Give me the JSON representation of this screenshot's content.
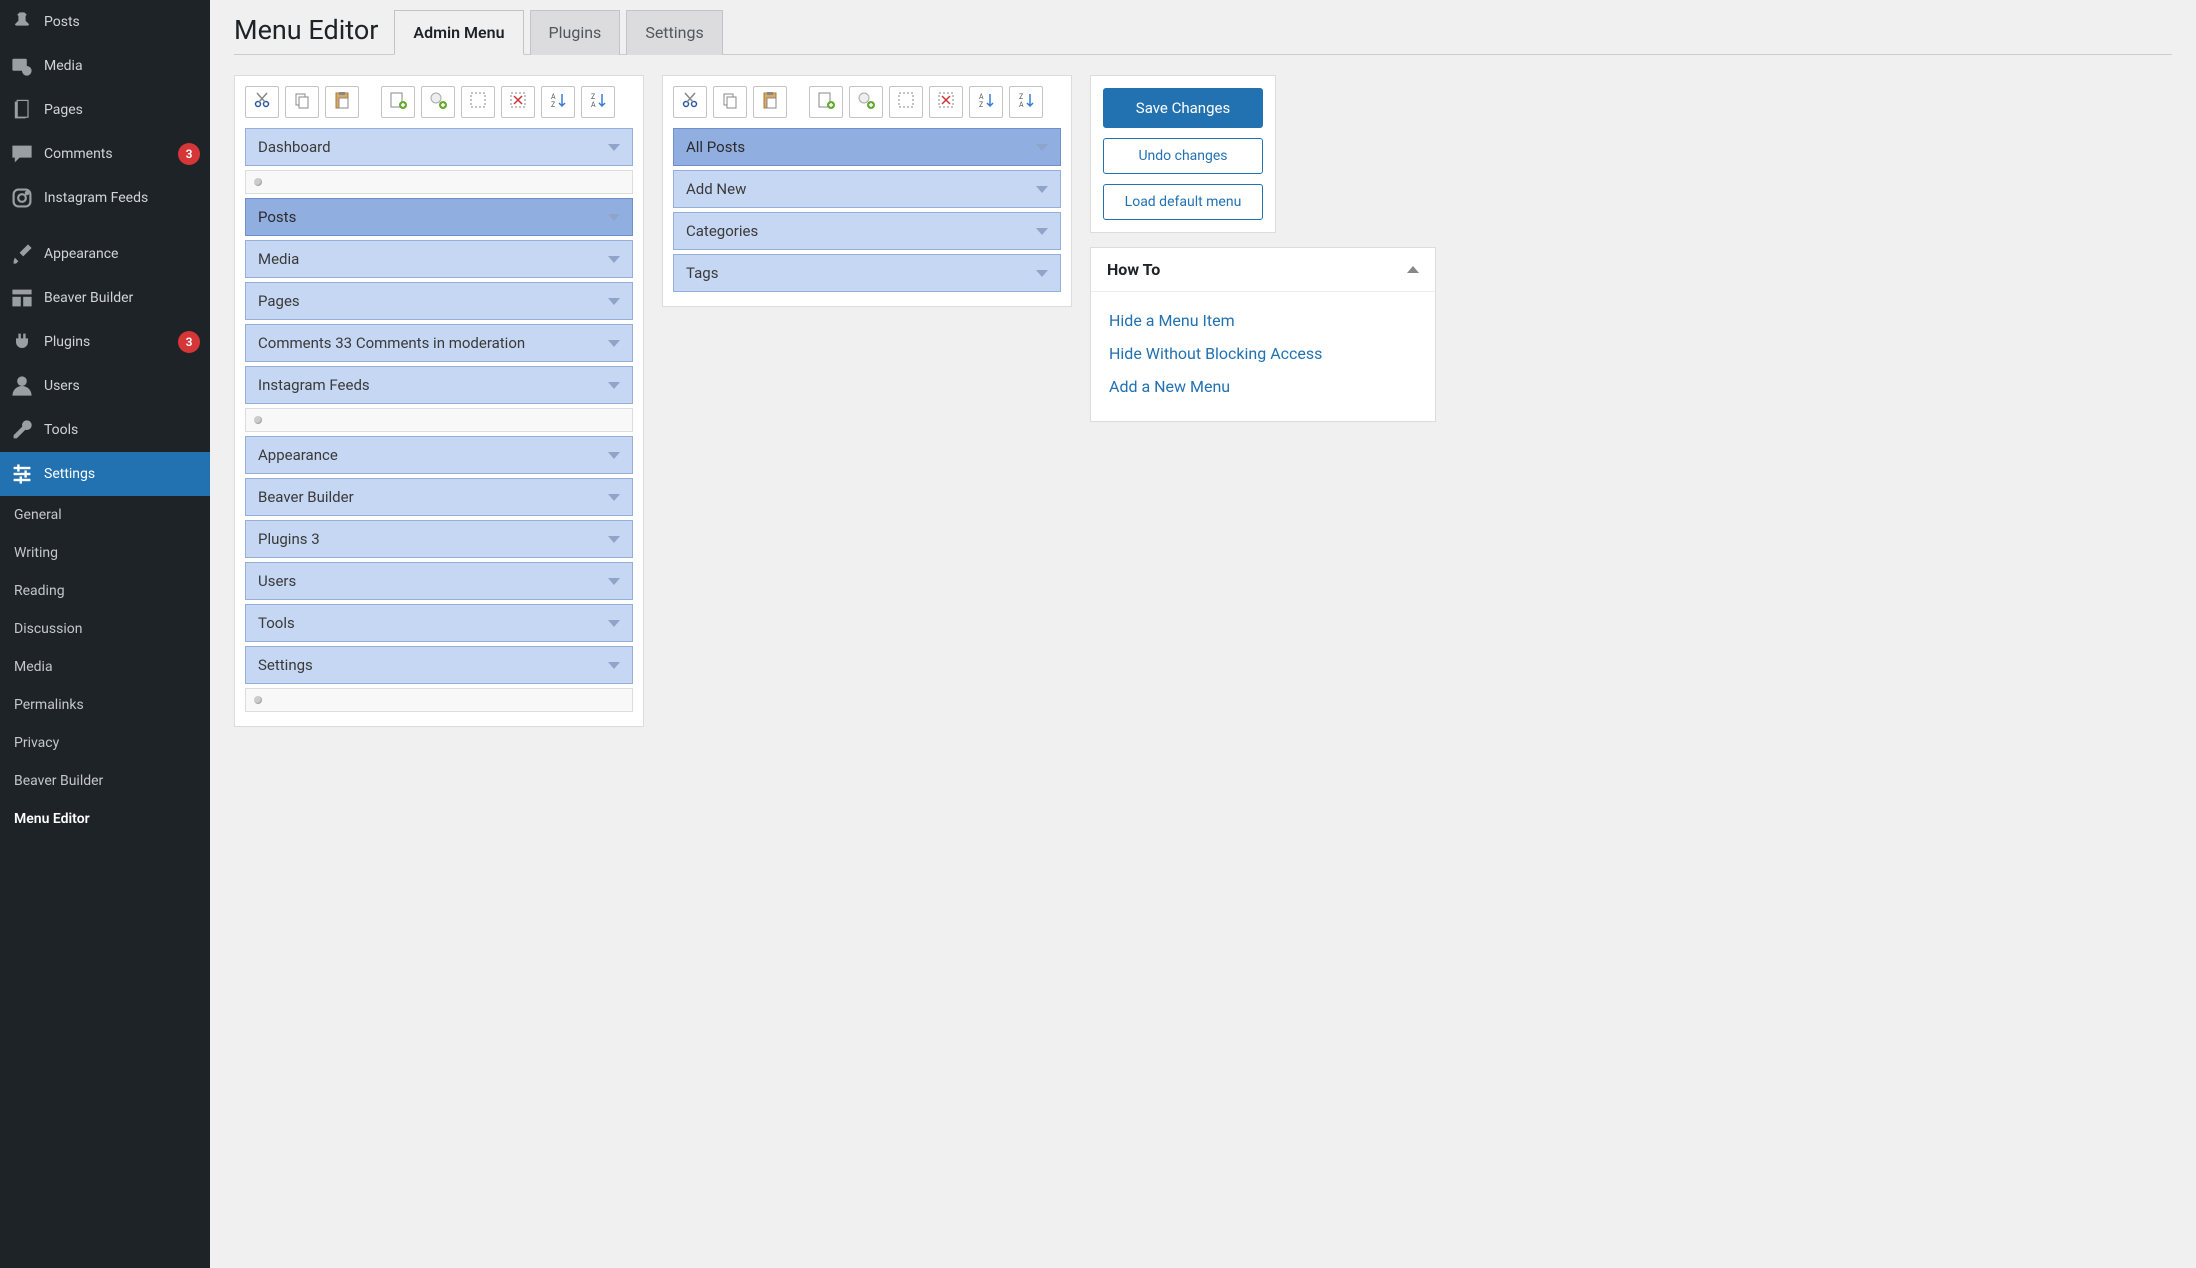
{
  "sidebar": {
    "items": [
      {
        "label": "Posts",
        "icon": "pin"
      },
      {
        "label": "Media",
        "icon": "media"
      },
      {
        "label": "Pages",
        "icon": "page"
      },
      {
        "label": "Comments",
        "icon": "comment",
        "badge": "3"
      },
      {
        "label": "Instagram Feeds",
        "icon": "instagram"
      },
      {
        "label": "Appearance",
        "icon": "brush"
      },
      {
        "label": "Beaver Builder",
        "icon": "layout"
      },
      {
        "label": "Plugins",
        "icon": "plug",
        "badge": "3"
      },
      {
        "label": "Users",
        "icon": "user"
      },
      {
        "label": "Tools",
        "icon": "wrench"
      },
      {
        "label": "Settings",
        "icon": "sliders",
        "active": true
      }
    ],
    "subitems": [
      {
        "label": "General"
      },
      {
        "label": "Writing"
      },
      {
        "label": "Reading"
      },
      {
        "label": "Discussion"
      },
      {
        "label": "Media"
      },
      {
        "label": "Permalinks"
      },
      {
        "label": "Privacy"
      },
      {
        "label": "Beaver Builder"
      },
      {
        "label": "Menu Editor",
        "active": true
      }
    ]
  },
  "page": {
    "title": "Menu Editor",
    "tabs": [
      {
        "label": "Admin Menu",
        "active": true
      },
      {
        "label": "Plugins"
      },
      {
        "label": "Settings"
      }
    ]
  },
  "main_menu": [
    {
      "type": "item",
      "label": "Dashboard"
    },
    {
      "type": "sep"
    },
    {
      "type": "item",
      "label": "Posts",
      "selected": true
    },
    {
      "type": "item",
      "label": "Media"
    },
    {
      "type": "item",
      "label": "Pages"
    },
    {
      "type": "item",
      "label": "Comments 33 Comments in moderation"
    },
    {
      "type": "item",
      "label": "Instagram Feeds"
    },
    {
      "type": "sep"
    },
    {
      "type": "item",
      "label": "Appearance"
    },
    {
      "type": "item",
      "label": "Beaver Builder"
    },
    {
      "type": "item",
      "label": "Plugins 3"
    },
    {
      "type": "item",
      "label": "Users"
    },
    {
      "type": "item",
      "label": "Tools"
    },
    {
      "type": "item",
      "label": "Settings"
    },
    {
      "type": "sep"
    }
  ],
  "sub_menu": [
    {
      "label": "All Posts",
      "selected": true
    },
    {
      "label": "Add New"
    },
    {
      "label": "Categories"
    },
    {
      "label": "Tags"
    }
  ],
  "actions": {
    "save": "Save Changes",
    "undo": "Undo changes",
    "load_default": "Load default menu"
  },
  "howto": {
    "title": "How To",
    "links": [
      "Hide a Menu Item",
      "Hide Without Blocking Access",
      "Add a New Menu"
    ]
  }
}
